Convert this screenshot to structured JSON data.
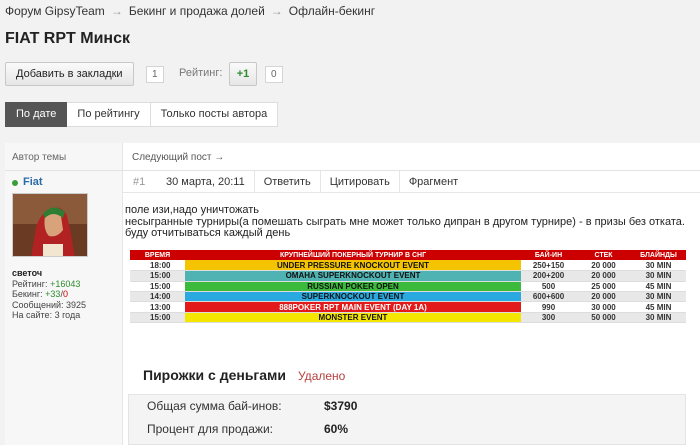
{
  "breadcrumb": [
    "Форум GipsyTeam",
    "Бекинг и продажа долей",
    "Офлайн-бекинг"
  ],
  "breadcrumb_sep": "→",
  "page_title": "FIAT RPT Минск",
  "bookmark": {
    "label": "Добавить в закладки",
    "count": "1"
  },
  "rating": {
    "label": "Рейтинг:",
    "plus": "+1",
    "count": "0"
  },
  "tabs": [
    "По дате",
    "По рейтингу",
    "Только посты автора"
  ],
  "author_header": "Автор темы",
  "next_post": "Следующий пост →",
  "author": {
    "name": "Fiat",
    "title": "светоч",
    "rating_label": "Рейтинг:",
    "rating_value": "+16043",
    "backing_label": "Бекинг:",
    "backing_pos": "+33",
    "backing_neg": "0",
    "messages": "Сообщений: 3925",
    "onsite": "На сайте: 3 года"
  },
  "post_meta": {
    "num": "#1",
    "date": "30 марта, 20:11",
    "reply": "Ответить",
    "quote": "Цитировать",
    "fragment": "Фрагмент"
  },
  "post_lines": [
    "поле изи,надо уничтожать",
    "несыгранные турниры(а помешать сыграть мне может только дипран в другом турнире) - в призы без отката.",
    "буду отчитываться каждый день"
  ],
  "schedule": {
    "headers": [
      "ВРЕМЯ",
      "КРУПНЕЙШИЙ ПОКЕРНЫЙ ТУРНИР В СНГ",
      "БАЙ-ИН",
      "СТЕК",
      "БЛАЙНДЫ"
    ],
    "rows": [
      {
        "time": "18:00",
        "event": "UNDER PRESSURE KNOCKOUT EVENT",
        "buyin": "250+150",
        "stack": "20 000",
        "blinds": "30 MIN",
        "color": "#f5c400"
      },
      {
        "time": "15:00",
        "event": "OMAHA SUPERKNOCKOUT EVENT",
        "buyin": "200+200",
        "stack": "20 000",
        "blinds": "30 MIN",
        "color": "#4fb3b3"
      },
      {
        "time": "15:00",
        "event": "RUSSIAN POKER OPEN",
        "buyin": "500",
        "stack": "25 000",
        "blinds": "45 MIN",
        "color": "#3cba3c"
      },
      {
        "time": "14:00",
        "event": "SUPERKNOCKOUT EVENT",
        "buyin": "600+600",
        "stack": "20 000",
        "blinds": "30 MIN",
        "color": "#2aa9e0"
      },
      {
        "time": "13:00",
        "event": "888POKER RPT MAIN EVENT (DAY 1A)",
        "buyin": "990",
        "stack": "30 000",
        "blinds": "45 MIN",
        "color": "#e21a1a"
      },
      {
        "time": "15:00",
        "event": "MONSTER EVENT",
        "buyin": "300",
        "stack": "50 000",
        "blinds": "30 MIN",
        "color": "#f5e600"
      }
    ]
  },
  "box_title": "Пирожки с деньгами",
  "deleted": "Удалено",
  "info": [
    {
      "label": "Общая сумма бай-инов:",
      "value": "$3790"
    },
    {
      "label": "Процент для продажи:",
      "value": "60%"
    }
  ]
}
